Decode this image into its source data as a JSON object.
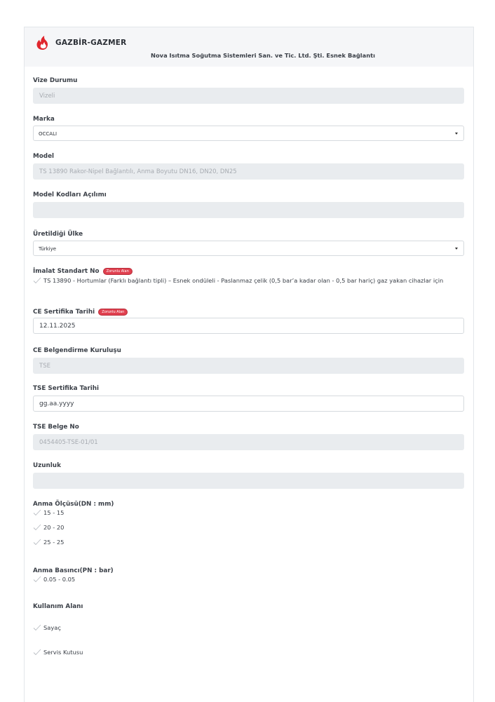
{
  "header": {
    "brand": "GAZBİR-GAZMER",
    "subtitle": "Nova Isıtma Soğutma Sistemleri San. ve Tic. Ltd. Şti. Esnek Bağlantı",
    "brand_color": "#e0262d"
  },
  "required_badge": "Zorunlu Alan",
  "fields": {
    "vize": {
      "label": "Vize Durumu",
      "value": "Vizeli"
    },
    "marka": {
      "label": "Marka",
      "value": "OCCALI"
    },
    "model": {
      "label": "Model",
      "value": "TS 13890  Rakor-Nipel Bağlantılı, Anma Boyutu DN16, DN20, DN25"
    },
    "model_kod": {
      "label": "Model Kodları Açılımı",
      "value": ""
    },
    "ulke": {
      "label": "Üretildiği Ülke",
      "value": "Türkiye"
    },
    "imalat": {
      "label": "İmalat Standart No",
      "items": [
        "TS 13890 - Hortumlar (Farklı bağlantı tipli) – Esnek ondüleli - Paslanmaz çelik (0,5 bar’a kadar olan - 0,5 bar hariç) gaz yakan cihazlar için"
      ]
    },
    "ce_tarih": {
      "label": "CE Sertifika Tarihi",
      "value": "12.11.2025"
    },
    "ce_kurulus": {
      "label": "CE Belgendirme Kuruluşu",
      "value": "TSE"
    },
    "tse_tarih": {
      "label": "TSE Sertifika Tarihi",
      "value": "gg.aa.yyyy"
    },
    "tse_no": {
      "label": "TSE Belge No",
      "value": "0454405-TSE-01/01"
    },
    "uzunluk": {
      "label": "Uzunluk",
      "value": ""
    },
    "anma_olcu": {
      "label": "Anma Ölçüsü(DN : mm)",
      "items": [
        "15 - 15",
        "20 - 20",
        "25 - 25"
      ]
    },
    "anma_basinc": {
      "label": "Anma Basıncı(PN : bar)",
      "items": [
        "0.05 - 0.05"
      ]
    },
    "kullanim": {
      "label": "Kullanım Alanı",
      "items": [
        "Sayaç",
        "Servis Kutusu"
      ]
    }
  }
}
